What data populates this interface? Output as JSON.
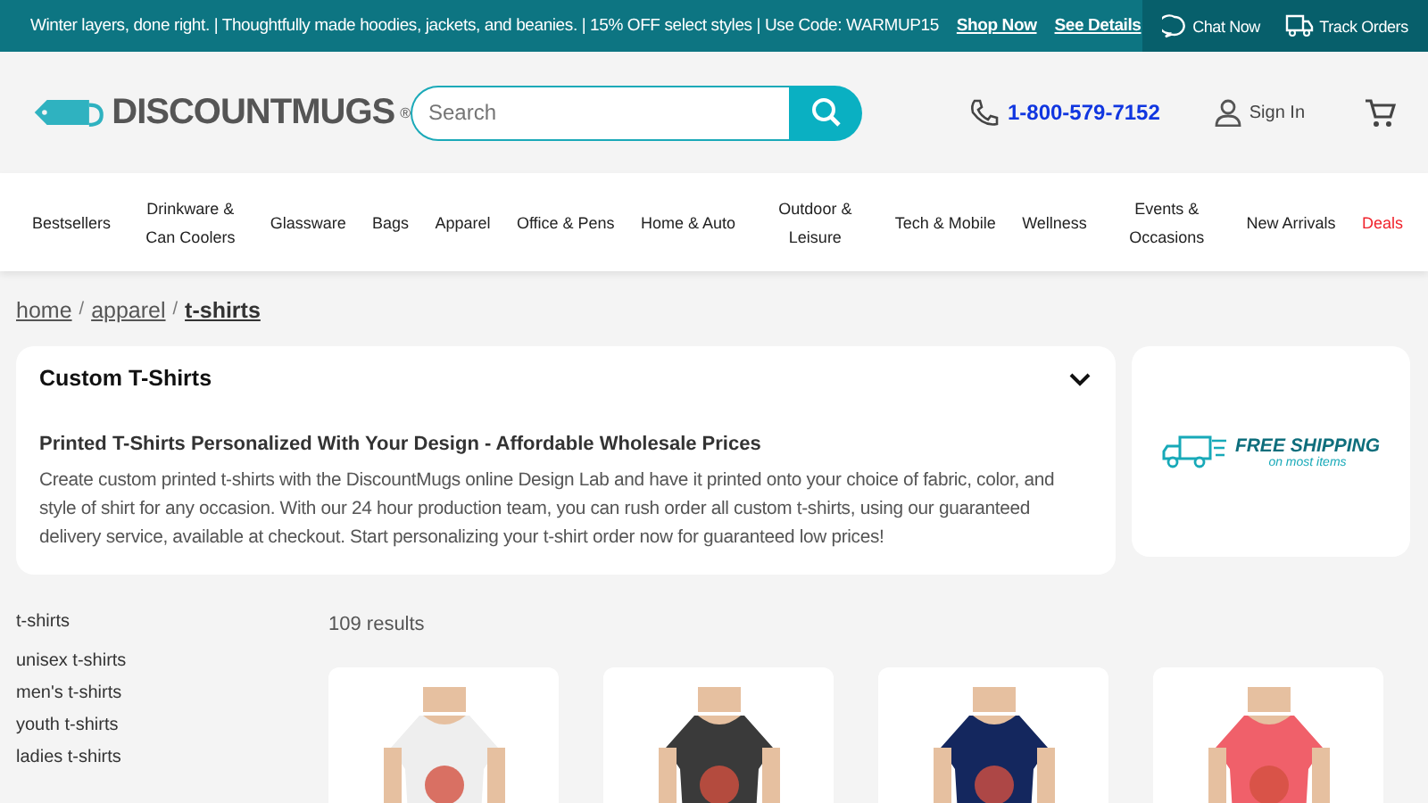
{
  "promo_bar": {
    "message": "Winter layers, done right. | Thoughtfully made hoodies, jackets, and beanies. | 15% OFF select styles | Use Code: WARMUP15",
    "links": [
      "Shop Now",
      "See Details"
    ],
    "actions": [
      "Chat Now",
      "Track Orders"
    ]
  },
  "header": {
    "logo": "DISCOUNTMUGS",
    "logo_mark": "®",
    "search": {
      "placeholder": "Search"
    },
    "phone": "1-800-579-7152",
    "sign_in": "Sign In"
  },
  "nav": [
    {
      "label": "Bestsellers",
      "kind": "normal"
    },
    {
      "label": "Drinkware & Can Coolers",
      "kind": "normal"
    },
    {
      "label": "Glassware",
      "kind": "normal"
    },
    {
      "label": "Bags",
      "kind": "normal"
    },
    {
      "label": "Apparel",
      "kind": "normal"
    },
    {
      "label": "Office & Pens",
      "kind": "normal"
    },
    {
      "label": "Home & Auto",
      "kind": "normal"
    },
    {
      "label": "Outdoor & Leisure",
      "kind": "normal"
    },
    {
      "label": "Tech & Mobile",
      "kind": "normal"
    },
    {
      "label": "Wellness",
      "kind": "normal"
    },
    {
      "label": "Events & Occasions",
      "kind": "normal"
    },
    {
      "label": "New Arrivals",
      "kind": "normal"
    },
    {
      "label": "Deals",
      "kind": "deal"
    }
  ],
  "breadcrumb_separator": "/",
  "breadcrumb": [
    {
      "label": "home",
      "selected": false
    },
    {
      "label": "apparel",
      "selected": false
    },
    {
      "label": "t-shirts",
      "selected": true
    }
  ],
  "info_card": {
    "title": "Custom T-Shirts",
    "expanded": true,
    "subtitle": "Printed T-Shirts Personalized With Your Design - Affordable Wholesale Prices",
    "body": "Create custom printed t-shirts with the DiscountMugs online Design Lab and have it printed onto your choice of fabric, color, and style of shirt for any occasion. With our 24 hour production team, you can rush order all custom t-shirts, using our guaranteed delivery service, available at checkout. Start personalizing your t-shirt order now for guaranteed low prices!"
  },
  "shipping_banner": {
    "title": "FREE SHIPPING",
    "subtitle": "on most items"
  },
  "sidebar": {
    "heading": "t-shirts",
    "items": [
      "unisex t-shirts",
      "men's t-shirts",
      "youth t-shirts",
      "ladies t-shirts"
    ]
  },
  "results": {
    "count": "109 results"
  }
}
